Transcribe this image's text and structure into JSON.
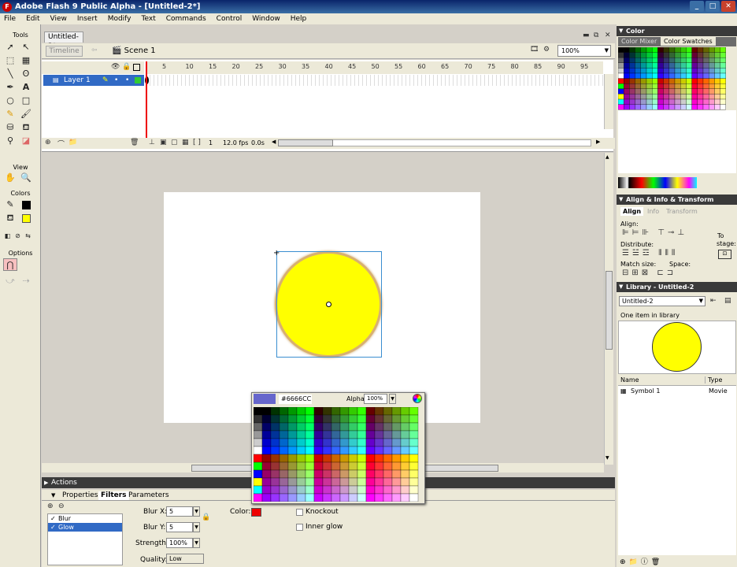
{
  "window": {
    "title": "Adobe Flash 9 Public Alpha - [Untitled-2*]",
    "logo": "F"
  },
  "menu": [
    "File",
    "Edit",
    "View",
    "Insert",
    "Modify",
    "Text",
    "Commands",
    "Control",
    "Window",
    "Help"
  ],
  "tools": {
    "header": "Tools",
    "view_label": "View",
    "colors_label": "Colors",
    "options_label": "Options",
    "icons": [
      "arrow-icon",
      "subselect-icon",
      "free-transform-icon",
      "gradient-icon",
      "line-icon",
      "lasso-icon",
      "pen-icon",
      "text-icon",
      "oval-icon",
      "rect-icon",
      "pencil-icon",
      "brush-icon",
      "ink-bottle-icon",
      "paint-bucket-icon",
      "eyedropper-icon",
      "eraser-icon"
    ]
  },
  "document": {
    "tab": "Untitled-2*",
    "timeline_button": "Timeline",
    "scene": "Scene 1",
    "zoom": "100%"
  },
  "timeline": {
    "layer": "Layer 1",
    "frame_numbers": [
      "5",
      "10",
      "15",
      "20",
      "25",
      "30",
      "35",
      "40",
      "45",
      "50",
      "55",
      "60",
      "65",
      "70",
      "75",
      "80",
      "85",
      "90",
      "95"
    ],
    "current_frame": "1",
    "fps": "12.0 fps",
    "time": "0.0s"
  },
  "panels": {
    "actions": "Actions",
    "tabs": [
      "Properties",
      "Filters",
      "Parameters"
    ],
    "active_tab": "Filters"
  },
  "filters": {
    "items": [
      "Blur",
      "Glow"
    ],
    "selected": "Glow",
    "blur_x_label": "Blur X:",
    "blur_x": "5",
    "blur_y_label": "Blur Y:",
    "blur_y": "5",
    "strength_label": "Strength:",
    "strength": "100%",
    "quality_label": "Quality:",
    "quality": "Low",
    "color_label": "Color:",
    "knockout": "Knockout",
    "inner_glow": "Inner glow",
    "glow_color": "#ee0000"
  },
  "palette": {
    "hex": "#6666CC",
    "alpha_label": "Alpha:",
    "alpha": "100%",
    "preview_color": "#6666cc"
  },
  "color_panel": {
    "title": "Color",
    "tabs": [
      "Color Mixer",
      "Color Swatches"
    ],
    "active": "Color Swatches"
  },
  "align_panel": {
    "title": "Align & Info & Transform",
    "tabs": [
      "Align",
      "Info",
      "Transform"
    ],
    "align": "Align:",
    "distribute": "Distribute:",
    "match_size": "Match size:",
    "space": "Space:",
    "to_stage_1": "To",
    "to_stage_2": "stage:"
  },
  "library": {
    "title": "Library - Untitled-2",
    "doc": "Untitled-2",
    "count": "One item in library",
    "col_name": "Name",
    "col_type": "Type",
    "item_name": "Symbol 1",
    "item_type": "Movie"
  },
  "stage": {
    "fill": "#ffff00",
    "stroke": "#d8b070"
  }
}
